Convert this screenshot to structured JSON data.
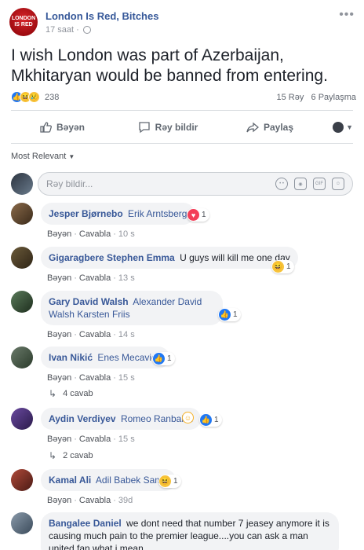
{
  "post": {
    "page_name": "London Is Red, Bitches",
    "avatar_text": "LONDON IS RED",
    "time": "17 saat",
    "text": "I wish London was part of Azerbaijan, Mkhitaryan would be banned from entering.",
    "reaction_count": "238",
    "comments_count": "15 Rəy",
    "shares_count": "6 Paylaşma"
  },
  "actions": {
    "like": "Bəyən",
    "comment": "Rəy bildir",
    "share": "Paylaş"
  },
  "sort_label": "Most Relevant",
  "composer": {
    "placeholder": "Rəy bildir..."
  },
  "comment_actions": {
    "like": "Bəyən",
    "reply": "Cavabla"
  },
  "comments": [
    {
      "author": "Jesper Bjørnebo",
      "mention": "Erik Arntsberg",
      "text": "",
      "reaction": "love-icon",
      "reaction_count": "1",
      "time": "10 s"
    },
    {
      "author": "Gigaragbere Stephen Emma",
      "mention": "",
      "text": "U guys will kill me one day",
      "reaction": "haha-icon",
      "reaction_count": "1",
      "time": "13 s"
    },
    {
      "author": "Gary David Walsh",
      "mention": "Alexander David Walsh",
      "mention2": "Karsten Friis",
      "text": "",
      "reaction": "like-icon",
      "reaction_count": "1",
      "time": "14 s"
    },
    {
      "author": "Ivan Nikić",
      "mention": "Enes Mecavica",
      "text": "",
      "reaction": "like-icon",
      "reaction_count": "1",
      "time": "15 s",
      "replies": "4 cavab"
    },
    {
      "author": "Aydin Verdiyev",
      "mention": "Romeo Ranbaksi",
      "text": "",
      "reaction": "like-icon",
      "reaction_count": "1",
      "time": "15 s",
      "replies": "2 cavab"
    },
    {
      "author": "Kamal Ali",
      "mention": "Adil Babek Samir",
      "text": "",
      "reaction": "haha-icon",
      "reaction_count": "1",
      "time": "39d"
    },
    {
      "author": "Bangalee Daniel",
      "mention": "",
      "text": "we dont need that number 7 jeasey anymore it is causing much pain to the premier league....you can ask a man united fan what i mean"
    }
  ],
  "colors": {
    "link": "#385898",
    "like": "#2078f4",
    "love": "#f33e58",
    "haha": "#f7c33b",
    "bubble": "#f2f3f5"
  }
}
